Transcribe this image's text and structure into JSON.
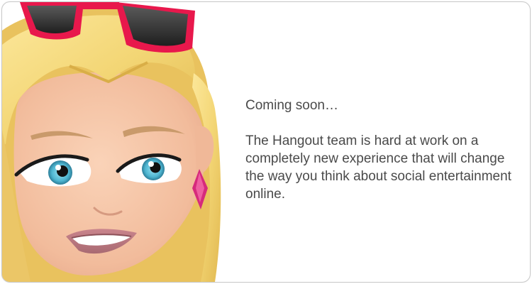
{
  "dialog": {
    "heading": "Coming soon…",
    "body": "The Hangout team is hard at work on a completely new experience that will change the way you think about social entertainment online."
  },
  "avatar": {
    "icon": "cartoon-avatar-blonde-woman-sunglasses",
    "colors": {
      "hair": "#F3D675",
      "skin": "#F6C5A7",
      "sunglasses_frame": "#E8184C",
      "eyes": "#4FB6D1",
      "earring": "#D62A7C"
    }
  }
}
